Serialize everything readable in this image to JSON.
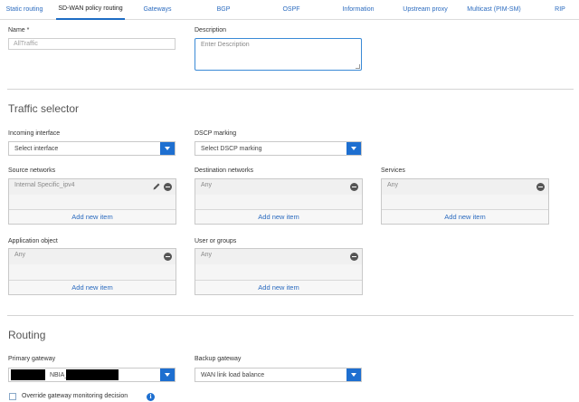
{
  "tabs": [
    {
      "label": "Static routing"
    },
    {
      "label": "SD-WAN policy routing"
    },
    {
      "label": "Gateways"
    },
    {
      "label": "BGP"
    },
    {
      "label": "OSPF"
    },
    {
      "label": "Information"
    },
    {
      "label": "Upstream proxy"
    },
    {
      "label": "Multicast (PIM-SM)"
    },
    {
      "label": "RIP"
    }
  ],
  "active_tab": "SD-WAN policy routing",
  "form": {
    "name_label": "Name *",
    "name_value": "AllTraffic",
    "description_label": "Description",
    "description_placeholder": "Enter Description"
  },
  "traffic_selector": {
    "title": "Traffic selector",
    "incoming_interface_label": "Incoming interface",
    "incoming_interface_value": "Select interface",
    "dscp_label": "DSCP marking",
    "dscp_value": "Select DSCP marking",
    "source_networks_label": "Source networks",
    "source_networks_item": "Internal Specific_ipv4",
    "destination_networks_label": "Destination networks",
    "destination_networks_item": "Any",
    "services_label": "Services",
    "services_item": "Any",
    "application_object_label": "Application object",
    "application_object_item": "Any",
    "user_groups_label": "User or groups",
    "user_groups_item": "Any",
    "add_new_item": "Add new item"
  },
  "routing": {
    "title": "Routing",
    "primary_gateway_label": "Primary gateway",
    "primary_gateway_value_visible": "NBIA_",
    "backup_gateway_label": "Backup gateway",
    "backup_gateway_value": "WAN link load balance",
    "override_label": "Override gateway monitoring decision"
  },
  "colors": {
    "accent": "#1e6fd0",
    "link": "#2b6bbf"
  }
}
